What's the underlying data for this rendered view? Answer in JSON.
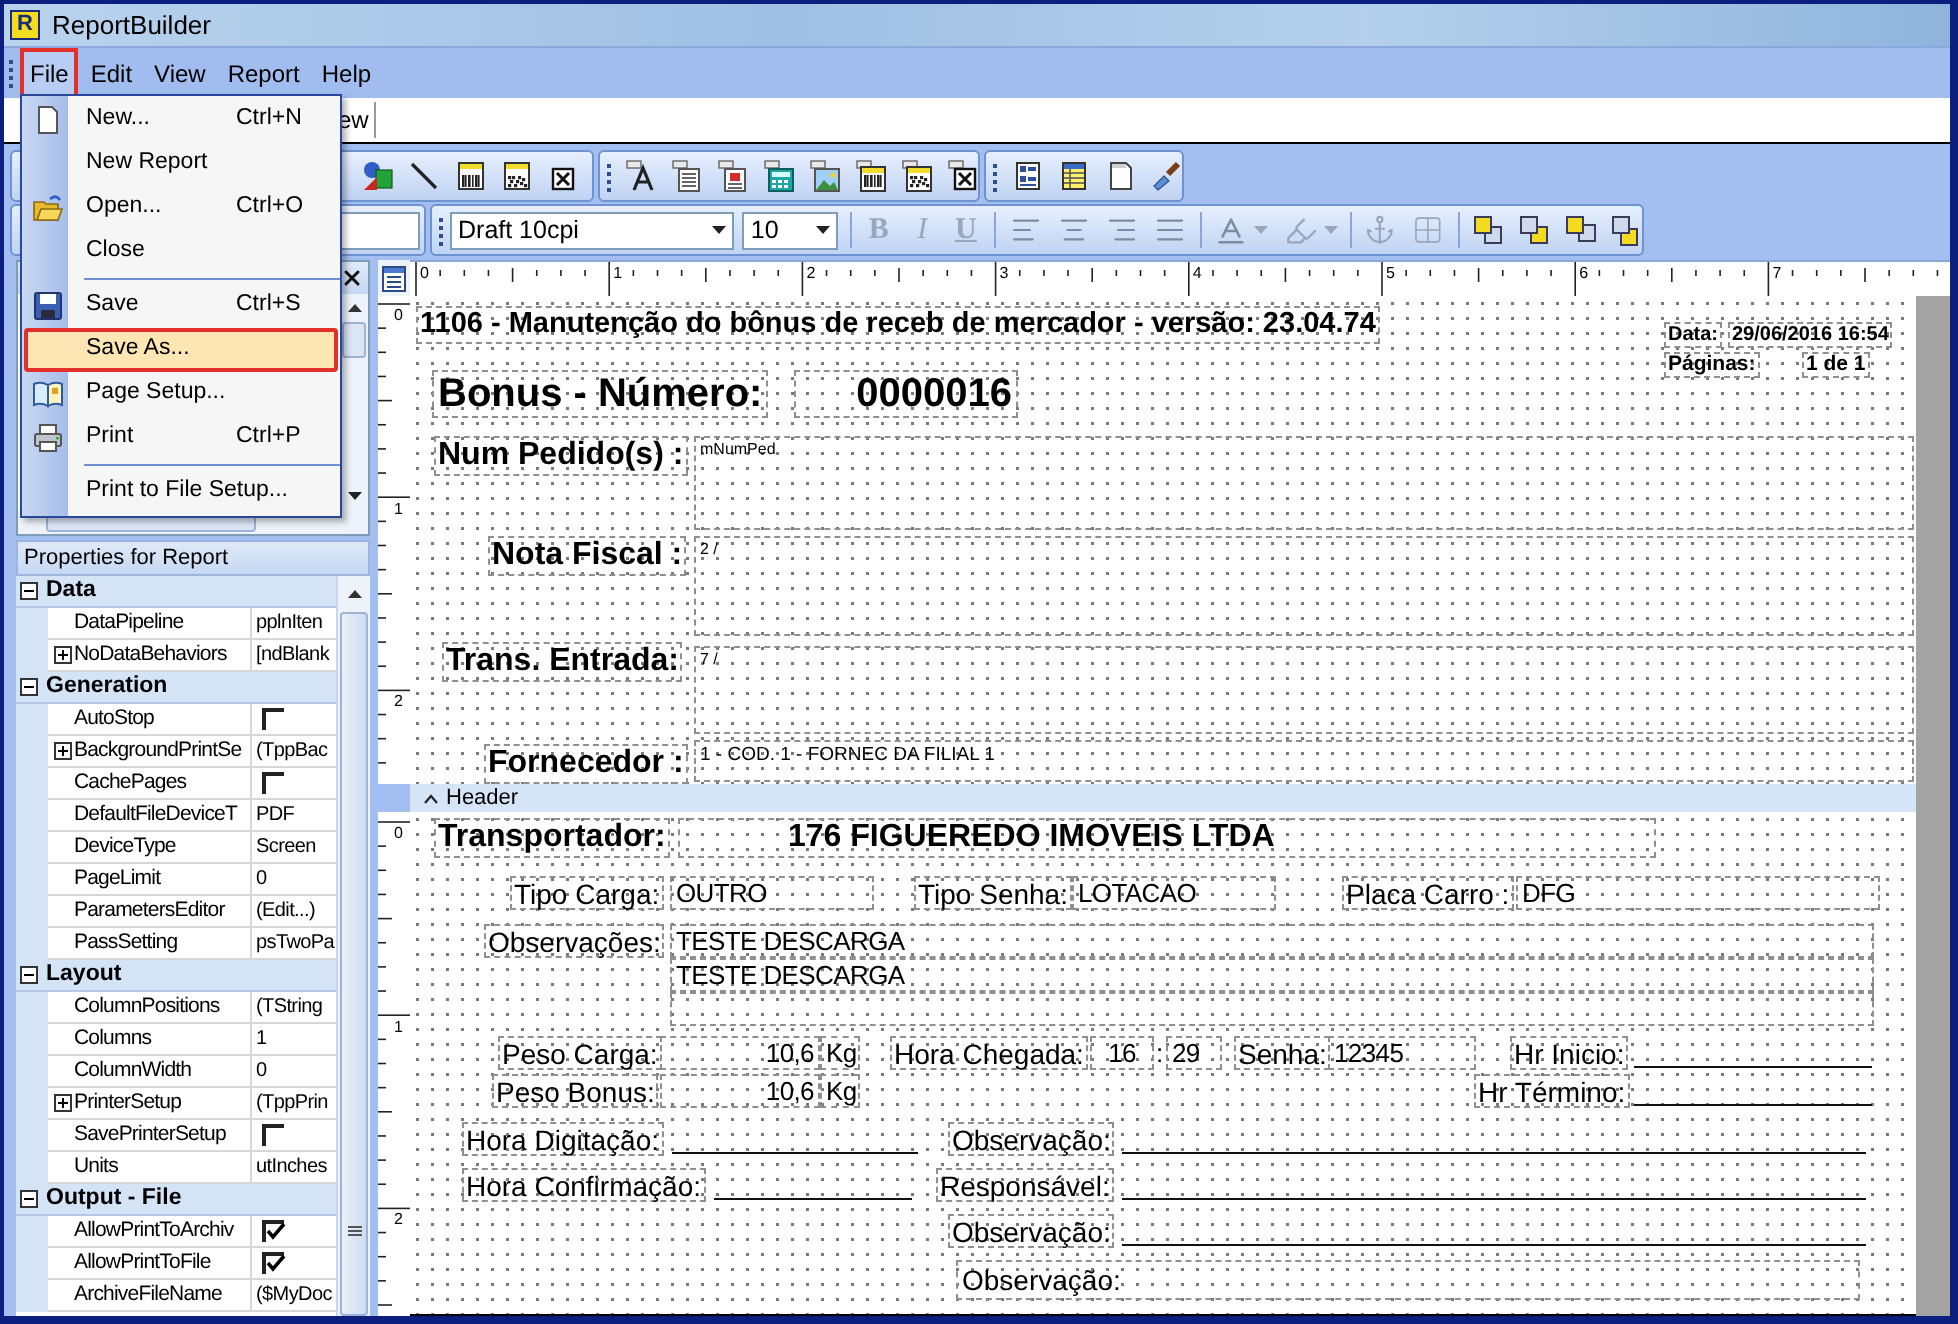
{
  "window": {
    "title": "ReportBuilder",
    "icon_letter": "R"
  },
  "menu_bar": [
    {
      "label": "File",
      "selected": true
    },
    {
      "label": "Edit",
      "selected": false
    },
    {
      "label": "View",
      "selected": false
    },
    {
      "label": "Report",
      "selected": false
    },
    {
      "label": "Help",
      "selected": false
    }
  ],
  "file_menu": [
    {
      "kind": "item",
      "label": "New...",
      "shortcut": "Ctrl+N",
      "selected": false
    },
    {
      "kind": "item",
      "label": "New Report",
      "selected": false
    },
    {
      "kind": "item",
      "label": "Open...",
      "shortcut": "Ctrl+O",
      "selected": false
    },
    {
      "kind": "item",
      "label": "Close",
      "selected": false
    },
    {
      "kind": "separator"
    },
    {
      "kind": "item",
      "label": "Save",
      "shortcut": "Ctrl+S",
      "selected": false
    },
    {
      "kind": "item",
      "label": "Save As...",
      "selected": true
    },
    {
      "kind": "item",
      "label": "Page Setup...",
      "selected": false
    },
    {
      "kind": "item",
      "label": "Print",
      "shortcut": "Ctrl+P",
      "selected": false
    },
    {
      "kind": "separator"
    },
    {
      "kind": "item",
      "label": "Print to File Setup...",
      "selected": false
    }
  ],
  "view_tabs": [
    {
      "label": "ew"
    }
  ],
  "format_toolbar": {
    "font": "Draft 10cpi",
    "size": "10",
    "style_buttons": [
      {
        "label": "B",
        "disabled": true
      },
      {
        "label": "I",
        "disabled": true
      },
      {
        "label": "U",
        "disabled": true
      }
    ]
  },
  "properties": {
    "title": "Properties for Report",
    "categories": [
      {
        "name": "Data",
        "expanded": true,
        "rows": [
          {
            "name": "DataPipeline",
            "kind": "text",
            "value": "pplnIten"
          },
          {
            "name": "NoDataBehaviors",
            "kind": "set",
            "expanded": false,
            "value": "[ndBlank"
          }
        ]
      },
      {
        "name": "Generation",
        "expanded": true,
        "rows": [
          {
            "name": "AutoStop",
            "kind": "checkbox",
            "checked": false
          },
          {
            "name": "BackgroundPrintSe",
            "kind": "set",
            "expanded": false,
            "value": "(TppBac"
          },
          {
            "name": "CachePages",
            "kind": "checkbox",
            "checked": false
          },
          {
            "name": "DefaultFileDeviceT",
            "kind": "text",
            "value": "PDF"
          },
          {
            "name": "DeviceType",
            "kind": "text",
            "value": "Screen"
          },
          {
            "name": "PageLimit",
            "kind": "text",
            "value": "0"
          },
          {
            "name": "ParametersEditor",
            "kind": "text",
            "value": "(Edit...)"
          },
          {
            "name": "PassSetting",
            "kind": "text",
            "value": "psTwoPa"
          }
        ]
      },
      {
        "name": "Layout",
        "expanded": true,
        "rows": [
          {
            "name": "ColumnPositions",
            "kind": "text",
            "value": "(TString"
          },
          {
            "name": "Columns",
            "kind": "text",
            "value": "1"
          },
          {
            "name": "ColumnWidth",
            "kind": "text",
            "value": "0"
          },
          {
            "name": "PrinterSetup",
            "kind": "set",
            "expanded": false,
            "value": "(TppPrin"
          },
          {
            "name": "SavePrinterSetup",
            "kind": "checkbox",
            "checked": false
          },
          {
            "name": "Units",
            "kind": "text",
            "value": "utInches"
          }
        ]
      },
      {
        "name": "Output - File",
        "expanded": true,
        "rows": [
          {
            "name": "AllowPrintToArchiv",
            "kind": "checkbox",
            "checked": true
          },
          {
            "name": "AllowPrintToFile",
            "kind": "checkbox",
            "checked": true
          },
          {
            "name": "ArchiveFileName",
            "kind": "text",
            "value": "($MyDoc"
          }
        ]
      }
    ]
  },
  "rulers": {
    "horizontal": [
      "0",
      "1",
      "2",
      "3",
      "4",
      "5",
      "6",
      "7"
    ],
    "vertical_bands": [
      {
        "labels": [
          "0",
          "1",
          "2"
        ]
      },
      {
        "labels": [
          "0",
          "1",
          "2"
        ]
      }
    ]
  },
  "report": {
    "title": "1106 - Manutenção do bônus de receb de mercador - versão: 23.04.74",
    "date": {
      "label": "Data:",
      "value": "29/06/2016 16:54"
    },
    "pages": {
      "label": "Páginas:",
      "value": "1 de 1"
    },
    "number": {
      "label": "Bonus - Número:",
      "value": "0000016"
    },
    "memo_fields": [
      {
        "label": "Num Pedido(s) :",
        "value": "mNumPed"
      },
      {
        "label": "Nota Fiscal :",
        "value": "2 /"
      },
      {
        "label": "Trans. Entrada:",
        "value": "7 /"
      },
      {
        "label": "Fornecedor :",
        "value": "1 - COD. 1 - FORNEC DA FILIAL 1"
      }
    ],
    "band_label": "Header",
    "carrier": {
      "label": "Transportador:",
      "value": "176 FIGUEREDO IMOVEIS LTDA"
    },
    "cargo_fields": [
      {
        "label": "Tipo Carga:",
        "value": "OUTRO"
      },
      {
        "label": "Tipo Senha:",
        "value": "LOTACAO"
      },
      {
        "label": "Placa Carro :",
        "value": "DFG"
      }
    ],
    "observations": {
      "label": "Observações:",
      "lines": [
        "TESTE DESCARGA",
        "TESTE DESCARGA"
      ]
    },
    "weights": [
      {
        "label": "Peso Carga:",
        "value": "10,6",
        "unit": "Kg"
      },
      {
        "label": "Peso Bonus:",
        "value": "10,6",
        "unit": "Kg"
      }
    ],
    "arrival": {
      "label": "Hora Chegada:",
      "hour": "16",
      "separator": ":",
      "minute": "29"
    },
    "password": {
      "label": "Senha:",
      "value": "12345"
    },
    "time_fields": [
      {
        "label": "Hr Inicio:"
      },
      {
        "label": "Hr Término:"
      }
    ],
    "sign_fields": [
      {
        "label": "Hora Digitação:"
      },
      {
        "label": "Observação:"
      },
      {
        "label": "Hora Confirmação:"
      },
      {
        "label": "Responsável:"
      },
      {
        "label": "Observação:"
      }
    ],
    "final_field": {
      "label": "Observação:"
    }
  }
}
